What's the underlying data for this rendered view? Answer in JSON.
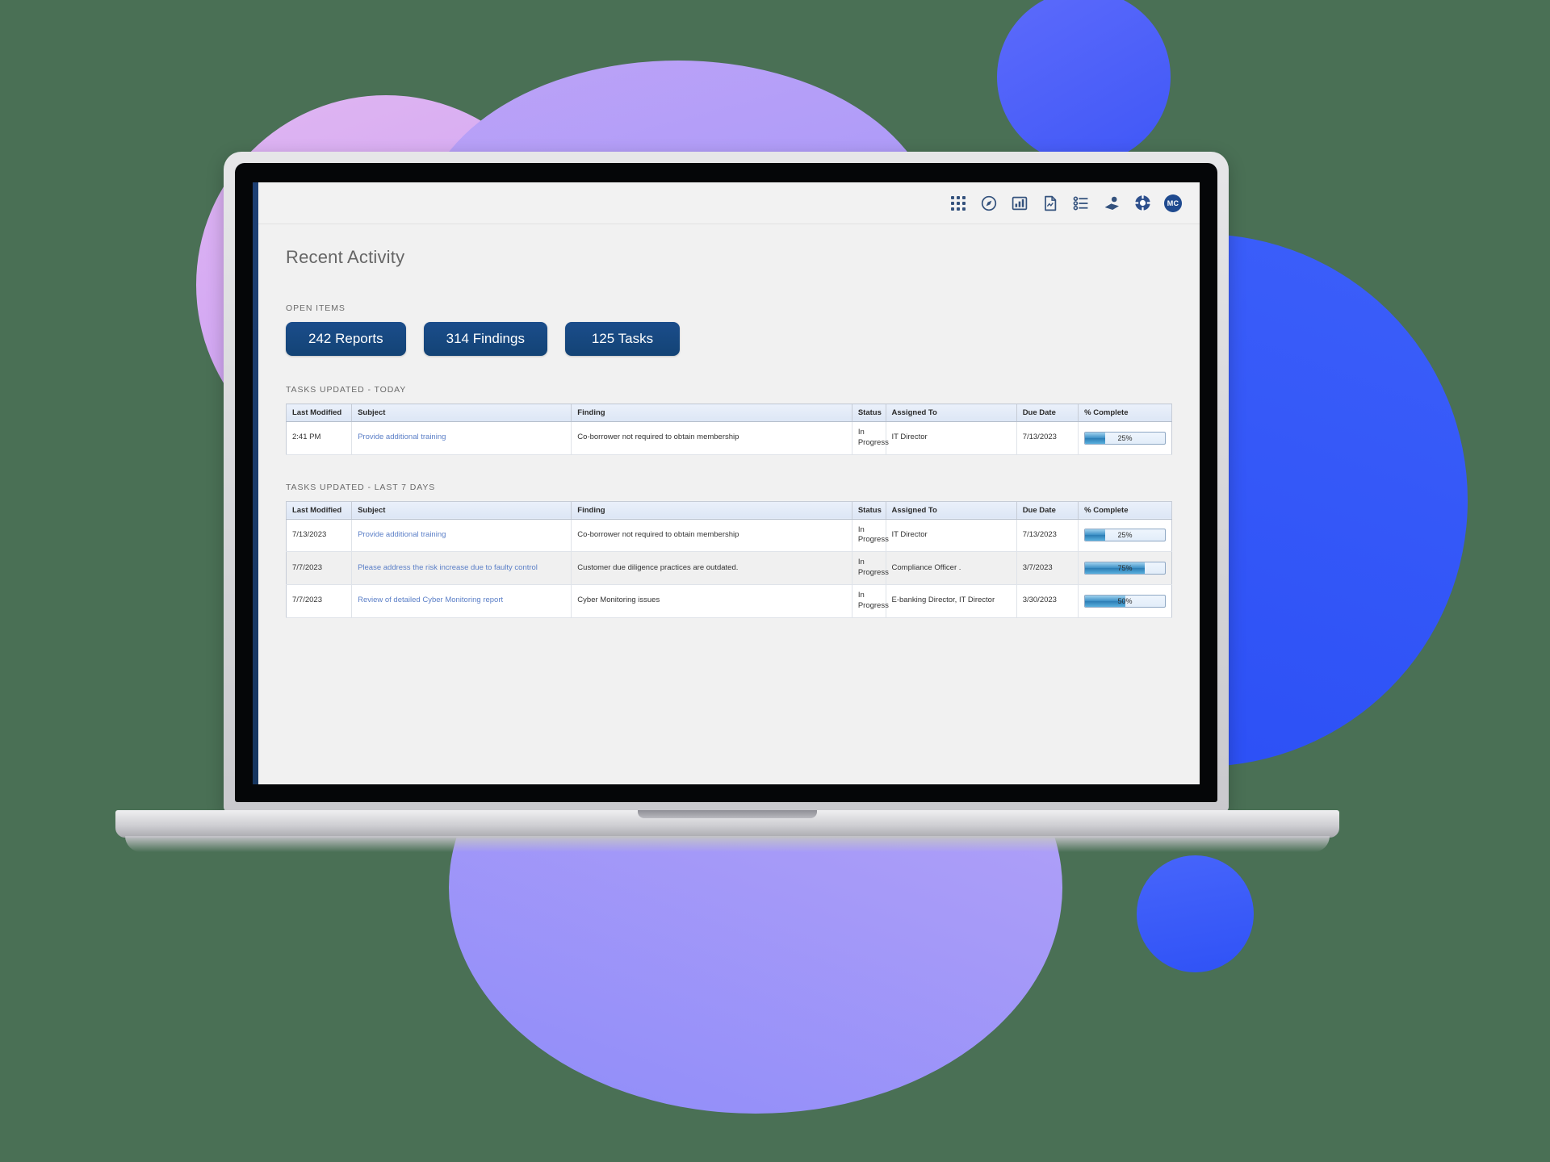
{
  "app": {
    "page_title": "Recent Activity",
    "topbar_icons": [
      {
        "name": "app-grid-icon",
        "label": "Apps"
      },
      {
        "name": "compass-icon",
        "label": "Navigator"
      },
      {
        "name": "bar-chart-icon",
        "label": "Reports"
      },
      {
        "name": "document-icon",
        "label": "Documents"
      },
      {
        "name": "checklist-icon",
        "label": "Tasks"
      },
      {
        "name": "training-icon",
        "label": "Training"
      },
      {
        "name": "lifebuoy-icon",
        "label": "Support"
      }
    ],
    "avatar_initials": "MC"
  },
  "open_items": {
    "label": "OPEN ITEMS",
    "buttons": [
      {
        "label": "242 Reports",
        "count": 242,
        "type": "Reports"
      },
      {
        "label": "314 Findings",
        "count": 314,
        "type": "Findings"
      },
      {
        "label": "125 Tasks",
        "count": 125,
        "type": "Tasks"
      }
    ]
  },
  "tables": [
    {
      "section_label": "TASKS UPDATED - TODAY",
      "columns": [
        "Last Modified",
        "Subject",
        "Finding",
        "Status",
        "Assigned To",
        "Due Date",
        "% Complete"
      ],
      "rows": [
        {
          "last_modified": "2:41 PM",
          "subject": "Provide additional training",
          "finding": "Co-borrower not required to obtain membership",
          "status": "In Progress",
          "assigned_to": "IT Director",
          "due_date": "7/13/2023",
          "percent_complete": 25,
          "percent_label": "25%"
        }
      ]
    },
    {
      "section_label": "TASKS UPDATED - LAST 7 DAYS",
      "columns": [
        "Last Modified",
        "Subject",
        "Finding",
        "Status",
        "Assigned To",
        "Due Date",
        "% Complete"
      ],
      "rows": [
        {
          "last_modified": "7/13/2023",
          "subject": "Provide additional training",
          "finding": "Co-borrower not required to obtain membership",
          "status": "In Progress",
          "assigned_to": "IT Director",
          "due_date": "7/13/2023",
          "percent_complete": 25,
          "percent_label": "25%"
        },
        {
          "last_modified": "7/7/2023",
          "subject": "Please address the risk increase due to faulty control",
          "finding": "Customer due diligence practices are outdated.",
          "status": "In Progress",
          "assigned_to": "Compliance Officer .",
          "due_date": "3/7/2023",
          "percent_complete": 75,
          "percent_label": "75%"
        },
        {
          "last_modified": "7/7/2023",
          "subject": "Review of detailed Cyber Monitoring report",
          "finding": "Cyber Monitoring issues",
          "status": "In Progress",
          "assigned_to": "E-banking Director, IT Director",
          "due_date": "3/30/2023",
          "percent_complete": 50,
          "percent_label": "50%"
        }
      ]
    }
  ],
  "colors": {
    "background": "#4a7055",
    "brand_blue": "#1b4d8b",
    "accent_blue": "#2f5af8",
    "accent_purple": "#a99cf5",
    "accent_pink": "#d3a6f3",
    "link": "#5b7fc7",
    "progress_fill": "#3f92c8"
  }
}
